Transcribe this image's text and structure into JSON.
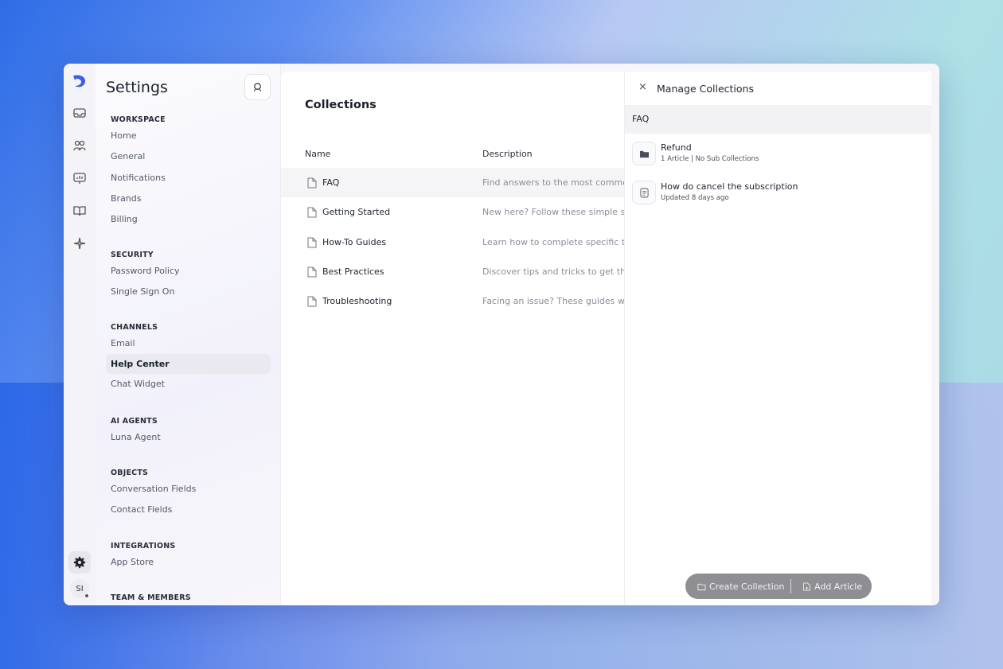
{
  "sidebar": {
    "title": "Settings",
    "sections": [
      {
        "title": "WORKSPACE",
        "items": [
          "Home",
          "General",
          "Notifications",
          "Brands",
          "Billing"
        ]
      },
      {
        "title": "SECURITY",
        "items": [
          "Password Policy",
          "Single Sign On"
        ]
      },
      {
        "title": "CHANNELS",
        "items": [
          "Email",
          "Help Center",
          "Chat Widget"
        ]
      },
      {
        "title": "AI AGENTS",
        "items": [
          "Luna Agent"
        ]
      },
      {
        "title": "OBJECTS",
        "items": [
          "Conversation Fields",
          "Contact Fields"
        ]
      },
      {
        "title": "INTEGRATIONS",
        "items": [
          "App Store"
        ]
      },
      {
        "title": "TEAM & MEMBERS",
        "items": []
      }
    ],
    "active_item": "Help Center"
  },
  "rail": {
    "avatar_initials": "SI",
    "icons": [
      "inbox-icon",
      "contacts-icon",
      "reports-icon",
      "knowledge-icon",
      "ai-icon"
    ]
  },
  "main": {
    "heading": "Collections",
    "columns": {
      "name": "Name",
      "description": "Description"
    },
    "rows": [
      {
        "name": "FAQ",
        "description": "Find answers to the most common"
      },
      {
        "name": "Getting Started",
        "description": "New here? Follow these simple step"
      },
      {
        "name": "How-To Guides",
        "description": "Learn how to complete specific tas"
      },
      {
        "name": "Best Practices",
        "description": "Discover tips and tricks to get the b"
      },
      {
        "name": "Troubleshooting",
        "description": "Facing an issue? These guides will h"
      }
    ]
  },
  "panel": {
    "close_glyph": "×",
    "title": "Manage Collections",
    "breadcrumb": "FAQ",
    "items": [
      {
        "type": "folder",
        "title": "Refund",
        "subtitle": "1 Article | No Sub Collections"
      },
      {
        "type": "article",
        "title": "How do cancel the subscription",
        "subtitle": "Updated 8 days ago"
      }
    ],
    "actions": {
      "create_collection": "Create Collection",
      "add_article": "Add Article"
    }
  },
  "colors": {
    "accent": "#3f5fe0",
    "actionbar": "#8e8e93",
    "active_item_bg": "#e9e9ef"
  }
}
